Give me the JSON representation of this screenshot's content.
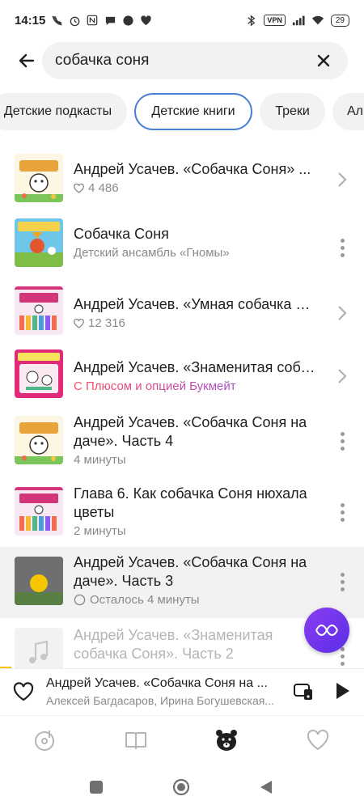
{
  "status_bar": {
    "time": "14:15",
    "vpn_label": "VPN",
    "battery": "29"
  },
  "search": {
    "query": "собачка соня"
  },
  "chips": [
    {
      "label": "Детские подкасты",
      "active": false
    },
    {
      "label": "Детские книги",
      "active": true
    },
    {
      "label": "Треки",
      "active": false
    },
    {
      "label": "Ал",
      "active": false
    }
  ],
  "results": [
    {
      "title": "Андрей Усачев. «Собачка Соня» ...",
      "subtitle": "4 486",
      "sub_icon": "heart-icon",
      "trailing": "chevron"
    },
    {
      "title": "Собачка Соня",
      "subtitle": "Детский ансамбль «Гномы»",
      "sub_icon": "",
      "trailing": "more"
    },
    {
      "title": "Андрей Усачев. «Умная собачка Соня» ...",
      "subtitle": "12 316",
      "sub_icon": "heart-icon",
      "trailing": "chevron"
    },
    {
      "title": "Андрей Усачев. «Знаменитая собачка Соня» ...",
      "subtitle": "С Плюсом и опцией Букмейт",
      "sub_icon": "",
      "trailing": "chevron"
    },
    {
      "title": "Андрей Усачев. «Собачка Соня на даче». Часть 4",
      "subtitle": "4 минуты",
      "sub_icon": "",
      "trailing": "more"
    },
    {
      "title": "Глава 6. Как собачка Соня нюхала цветы",
      "subtitle": "2 минуты",
      "sub_icon": "",
      "trailing": "more"
    },
    {
      "title": "Андрей Усачев. «Собачка Соня на даче». Часть 3",
      "subtitle": "Осталось 4 минуты",
      "sub_icon": "circle-icon",
      "trailing": "more"
    },
    {
      "title": "Андрей Усачев. «Знаменитая собачка Соня». Часть 2",
      "subtitle": "",
      "sub_icon": "",
      "trailing": "more"
    }
  ],
  "player": {
    "title": "Андрей Усачев. «Собачка Соня на ...",
    "artist": "Алексей Багдасаров, Ирина Богушевская..."
  },
  "colors": {
    "accent_chip_border": "#4b7fd6",
    "fab_purple": "#7b3ff0",
    "plus_gradient_start": "#ff4a5e",
    "plus_gradient_end": "#7b4dff",
    "progress_yellow": "#f7c600"
  }
}
